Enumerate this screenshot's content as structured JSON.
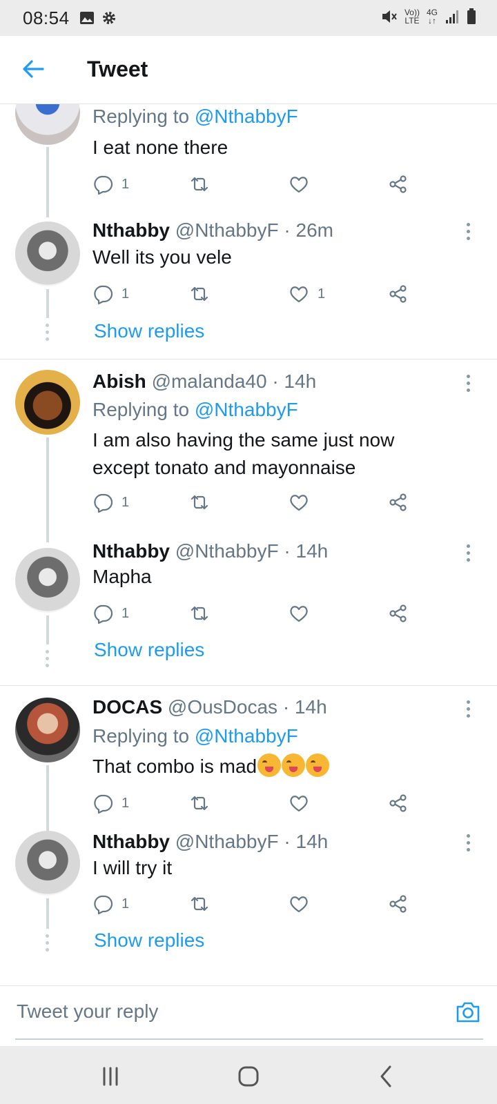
{
  "status_bar": {
    "time": "08:54",
    "sound_icon": "mute-icon",
    "volte_label": "Vo))",
    "lte_label": "LTE",
    "network_label": "4G"
  },
  "header": {
    "title": "Tweet"
  },
  "colors": {
    "accent": "#1d9bf0",
    "muted": "#657786",
    "text": "#14171a"
  },
  "tweets": [
    {
      "name": "",
      "handle": "",
      "time": "",
      "replying_label": "Replying to",
      "replying_handle": "@NthabbyF",
      "text": "I eat none there",
      "reply_count": "1",
      "like_count": ""
    },
    {
      "name": "Nthabby",
      "handle": "@NthabbyF",
      "time": "· 26m",
      "text": "Well its you vele",
      "reply_count": "1",
      "like_count": "1",
      "show_replies": "Show replies"
    },
    {
      "name": "Abish",
      "handle": "@malanda40",
      "time": "· 14h",
      "replying_label": "Replying to",
      "replying_handle": "@NthabbyF",
      "text": "I am also having the same just now except tonato and mayonnaise",
      "reply_count": "1",
      "like_count": ""
    },
    {
      "name": "Nthabby",
      "handle": "@NthabbyF",
      "time": "· 14h",
      "text": "Mapha",
      "reply_count": "1",
      "like_count": "",
      "show_replies": "Show replies"
    },
    {
      "name": "DOCAS",
      "handle": "@OusDocas",
      "time": "· 14h",
      "replying_label": "Replying to",
      "replying_handle": "@NthabbyF",
      "text": "That combo is mad",
      "emojis": [
        "😋",
        "😋",
        "😋"
      ],
      "reply_count": "1",
      "like_count": ""
    },
    {
      "name": "Nthabby",
      "handle": "@NthabbyF",
      "time": "· 14h",
      "text": "I will try it",
      "reply_count": "1",
      "like_count": "",
      "show_replies": "Show replies"
    }
  ],
  "compose": {
    "placeholder": "Tweet your reply"
  },
  "nav": {
    "recents_icon": "recents-icon",
    "home_icon": "home-icon",
    "back_icon": "back-icon"
  }
}
